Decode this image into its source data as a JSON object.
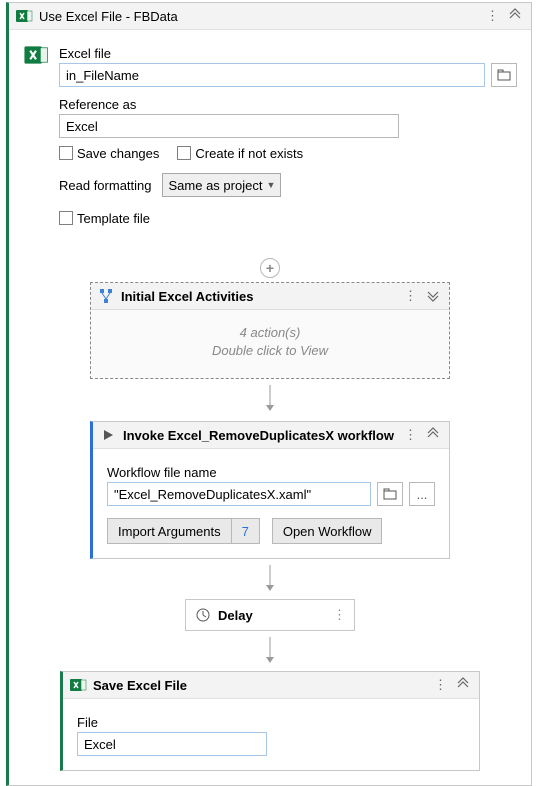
{
  "outer": {
    "title": "Use Excel File - FBData",
    "file_label": "Excel file",
    "file_value": "in_FileName",
    "ref_label": "Reference as",
    "ref_value": "Excel",
    "save_changes": "Save changes",
    "create_if_not_exists": "Create if not exists",
    "read_formatting_label": "Read formatting",
    "read_formatting_value": "Same as project",
    "template_file": "Template file"
  },
  "initial": {
    "title": "Initial Excel Activities",
    "line1": "4 action(s)",
    "line2": "Double click to View"
  },
  "invoke": {
    "title": "Invoke Excel_RemoveDuplicatesX workflow",
    "wf_label": "Workflow file name",
    "wf_value": "\"Excel_RemoveDuplicatesX.xaml\"",
    "import_btn": "Import Arguments",
    "import_count": "7",
    "open_btn": "Open Workflow"
  },
  "delay": {
    "title": "Delay"
  },
  "save": {
    "title": "Save Excel File",
    "file_label": "File",
    "file_value": "Excel"
  }
}
